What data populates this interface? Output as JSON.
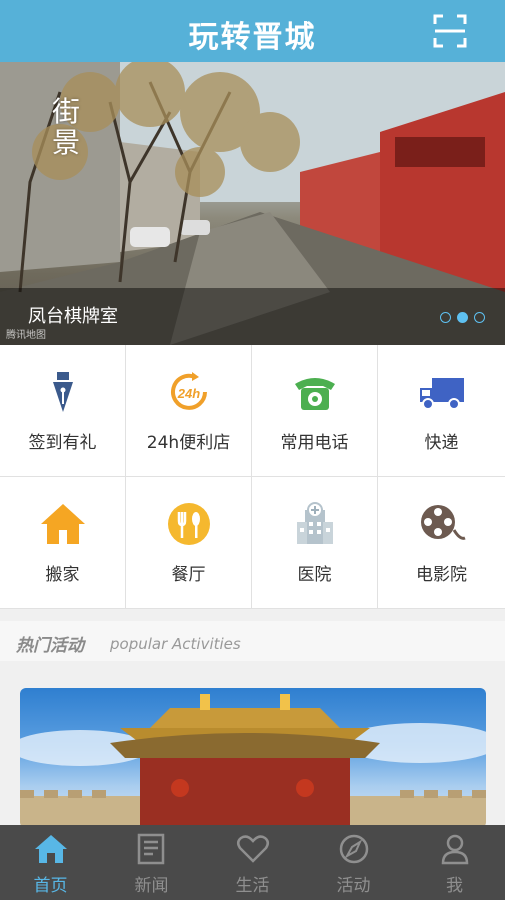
{
  "header": {
    "title": "玩转晋城",
    "scan_icon": "scan-icon"
  },
  "banner": {
    "caption": "凤台棋牌室",
    "badge": "街景",
    "watermark": "腾讯地图",
    "slides": 3,
    "active_slide": 2
  },
  "services": [
    {
      "label": "签到有礼",
      "icon": "fountain-pen-icon"
    },
    {
      "label": "24h便利店",
      "icon": "24h-clock-icon"
    },
    {
      "label": "常用电话",
      "icon": "telephone-icon"
    },
    {
      "label": "快递",
      "icon": "delivery-truck-icon"
    },
    {
      "label": "搬家",
      "icon": "house-icon"
    },
    {
      "label": "餐厅",
      "icon": "restaurant-icon"
    },
    {
      "label": "医院",
      "icon": "hospital-icon"
    },
    {
      "label": "电影院",
      "icon": "film-reel-icon"
    }
  ],
  "section": {
    "title_cn": "热门活动",
    "title_en": "popular Activities"
  },
  "tabs": [
    {
      "label": "首页",
      "icon": "home-icon",
      "active": true
    },
    {
      "label": "新闻",
      "icon": "newspaper-icon",
      "active": false
    },
    {
      "label": "生活",
      "icon": "heart-icon",
      "active": false
    },
    {
      "label": "活动",
      "icon": "compass-icon",
      "active": false
    },
    {
      "label": "我",
      "icon": "user-icon",
      "active": false
    }
  ],
  "colors": {
    "primary": "#56b1d8",
    "tabbar": "#4a4a4a",
    "tab_active": "#58b7e6"
  }
}
